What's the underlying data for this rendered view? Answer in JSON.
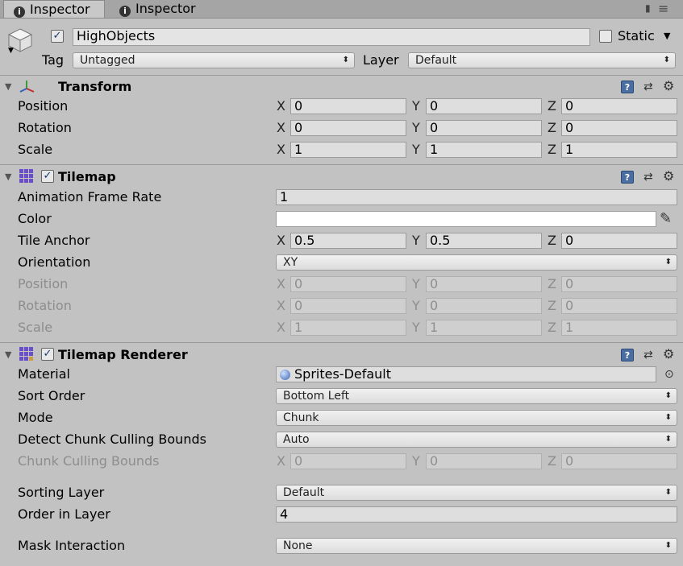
{
  "tabs": [
    {
      "label": "Inspector"
    },
    {
      "label": "Inspector"
    }
  ],
  "header": {
    "active": "✓",
    "name": "HighObjects",
    "static_label": "Static",
    "tag_label": "Tag",
    "tag_value": "Untagged",
    "layer_label": "Layer",
    "layer_value": "Default"
  },
  "transform": {
    "title": "Transform",
    "rows": [
      {
        "label": "Position",
        "x": "0",
        "y": "0",
        "z": "0"
      },
      {
        "label": "Rotation",
        "x": "0",
        "y": "0",
        "z": "0"
      },
      {
        "label": "Scale",
        "x": "1",
        "y": "1",
        "z": "1"
      }
    ]
  },
  "axes": {
    "x": "X",
    "y": "Y",
    "z": "Z"
  },
  "tilemap": {
    "title": "Tilemap",
    "enabled": "✓",
    "frame_rate_label": "Animation Frame Rate",
    "frame_rate": "1",
    "color_label": "Color",
    "color": "#ffffff",
    "anchor_label": "Tile Anchor",
    "anchor": {
      "x": "0.5",
      "y": "0.5",
      "z": "0"
    },
    "orientation_label": "Orientation",
    "orientation": "XY",
    "disabled_rows": [
      {
        "label": "Position",
        "x": "0",
        "y": "0",
        "z": "0"
      },
      {
        "label": "Rotation",
        "x": "0",
        "y": "0",
        "z": "0"
      },
      {
        "label": "Scale",
        "x": "1",
        "y": "1",
        "z": "1"
      }
    ]
  },
  "renderer": {
    "title": "Tilemap Renderer",
    "enabled": "✓",
    "material_label": "Material",
    "material": "Sprites-Default",
    "sort_order_label": "Sort Order",
    "sort_order": "Bottom Left",
    "mode_label": "Mode",
    "mode": "Chunk",
    "detect_label": "Detect Chunk Culling Bounds",
    "detect": "Auto",
    "bounds_label": "Chunk Culling Bounds",
    "bounds": {
      "x": "0",
      "y": "0",
      "z": "0"
    },
    "sorting_layer_label": "Sorting Layer",
    "sorting_layer": "Default",
    "order_label": "Order in Layer",
    "order": "4",
    "mask_label": "Mask Interaction",
    "mask": "None"
  },
  "icons": {
    "help": "?",
    "preset": "⇄",
    "gear": "⚙",
    "fold": "▼",
    "dd_arrow": "⬍",
    "lock": "🔒",
    "menu": "≡",
    "picker": "⊙",
    "eyedropper": "✎"
  }
}
